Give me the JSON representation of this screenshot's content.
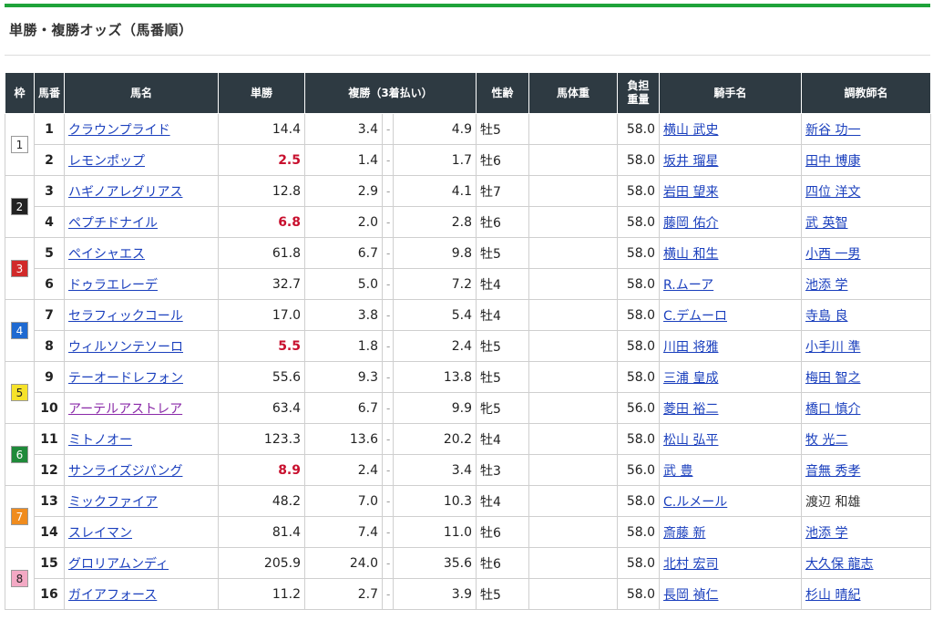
{
  "page": {
    "title": "単勝・複勝オッズ（馬番順）"
  },
  "colors": {
    "accent_bar": "#1fa33a",
    "header_bg": "#2e3a42",
    "link": "#1a3fbd",
    "visited_link": "#8a2aa8",
    "popular_odds": "#c8102e",
    "waku": {
      "1": "#ffffff",
      "2": "#222222",
      "3": "#d12a2a",
      "4": "#1f6ad1",
      "5": "#f6e22a",
      "6": "#1f8a3a",
      "7": "#f08c1e",
      "8": "#f3a9c4"
    }
  },
  "headers": {
    "waku": "枠",
    "umaban": "馬番",
    "name": "馬名",
    "tansho": "単勝",
    "fukusho": "複勝（3着払い）",
    "seirei": "性齢",
    "bataiju": "馬体重",
    "futan": "負担重量",
    "jockey": "騎手名",
    "trainer": "調教師名"
  },
  "horses": [
    {
      "waku": "1",
      "umaban": "1",
      "name": "クラウンプライド",
      "tansho": "14.4",
      "fmin": "3.4",
      "fmax": "4.9",
      "seirei": "牡5",
      "futan": "58.0",
      "jockey": "横山 武史",
      "trainer": "新谷 功一"
    },
    {
      "waku": "1",
      "umaban": "2",
      "name": "レモンポップ",
      "tansho": "2.5",
      "fmin": "1.4",
      "fmax": "1.7",
      "seirei": "牡6",
      "futan": "58.0",
      "jockey": "坂井 瑠星",
      "trainer": "田中 博康"
    },
    {
      "waku": "2",
      "umaban": "3",
      "name": "ハギノアレグリアス",
      "tansho": "12.8",
      "fmin": "2.9",
      "fmax": "4.1",
      "seirei": "牡7",
      "futan": "58.0",
      "jockey": "岩田 望来",
      "trainer": "四位 洋文"
    },
    {
      "waku": "2",
      "umaban": "4",
      "name": "ペプチドナイル",
      "tansho": "6.8",
      "fmin": "2.0",
      "fmax": "2.8",
      "seirei": "牡6",
      "futan": "58.0",
      "jockey": "藤岡 佑介",
      "trainer": "武 英智"
    },
    {
      "waku": "3",
      "umaban": "5",
      "name": "ペイシャエス",
      "tansho": "61.8",
      "fmin": "6.7",
      "fmax": "9.8",
      "seirei": "牡5",
      "futan": "58.0",
      "jockey": "横山 和生",
      "trainer": "小西 一男"
    },
    {
      "waku": "3",
      "umaban": "6",
      "name": "ドゥラエレーデ",
      "tansho": "32.7",
      "fmin": "5.0",
      "fmax": "7.2",
      "seirei": "牡4",
      "futan": "58.0",
      "jockey": "R.ムーア",
      "trainer": "池添 学"
    },
    {
      "waku": "4",
      "umaban": "7",
      "name": "セラフィックコール",
      "tansho": "17.0",
      "fmin": "3.8",
      "fmax": "5.4",
      "seirei": "牡4",
      "futan": "58.0",
      "jockey": "C.デムーロ",
      "trainer": "寺島 良"
    },
    {
      "waku": "4",
      "umaban": "8",
      "name": "ウィルソンテソーロ",
      "tansho": "5.5",
      "fmin": "1.8",
      "fmax": "2.4",
      "seirei": "牡5",
      "futan": "58.0",
      "jockey": "川田 将雅",
      "trainer": "小手川 準"
    },
    {
      "waku": "5",
      "umaban": "9",
      "name": "テーオードレフォン",
      "tansho": "55.6",
      "fmin": "9.3",
      "fmax": "13.8",
      "seirei": "牡5",
      "futan": "58.0",
      "jockey": "三浦 皇成",
      "trainer": "梅田 智之"
    },
    {
      "waku": "5",
      "umaban": "10",
      "name": "アーテルアストレア",
      "tansho": "63.4",
      "fmin": "6.7",
      "fmax": "9.9",
      "seirei": "牝5",
      "futan": "56.0",
      "jockey": "菱田 裕二",
      "trainer": "橋口 慎介"
    },
    {
      "waku": "6",
      "umaban": "11",
      "name": "ミトノオー",
      "tansho": "123.3",
      "fmin": "13.6",
      "fmax": "20.2",
      "seirei": "牡4",
      "futan": "58.0",
      "jockey": "松山 弘平",
      "trainer": "牧 光二"
    },
    {
      "waku": "6",
      "umaban": "12",
      "name": "サンライズジパング",
      "tansho": "8.9",
      "fmin": "2.4",
      "fmax": "3.4",
      "seirei": "牡3",
      "futan": "56.0",
      "jockey": "武 豊",
      "trainer": "音無 秀孝"
    },
    {
      "waku": "7",
      "umaban": "13",
      "name": "ミックファイア",
      "tansho": "48.2",
      "fmin": "7.0",
      "fmax": "10.3",
      "seirei": "牡4",
      "futan": "58.0",
      "jockey": "C.ルメール",
      "trainer": "渡辺 和雄"
    },
    {
      "waku": "7",
      "umaban": "14",
      "name": "スレイマン",
      "tansho": "81.4",
      "fmin": "7.4",
      "fmax": "11.0",
      "seirei": "牡6",
      "futan": "58.0",
      "jockey": "斎藤 新",
      "trainer": "池添 学"
    },
    {
      "waku": "8",
      "umaban": "15",
      "name": "グロリアムンディ",
      "tansho": "205.9",
      "fmin": "24.0",
      "fmax": "35.6",
      "seirei": "牡6",
      "futan": "58.0",
      "jockey": "北村 宏司",
      "trainer": "大久保 龍志"
    },
    {
      "waku": "8",
      "umaban": "16",
      "name": "ガイアフォース",
      "tansho": "11.2",
      "fmin": "2.7",
      "fmax": "3.9",
      "seirei": "牡5",
      "futan": "58.0",
      "jockey": "長岡 禎仁",
      "trainer": "杉山 晴紀"
    }
  ],
  "popular_umaban": [
    "2",
    "4",
    "8",
    "12"
  ],
  "visited_name_umaban": [
    "10"
  ],
  "plain_trainer_umaban": [
    "13"
  ],
  "fukusho_separator": "-"
}
